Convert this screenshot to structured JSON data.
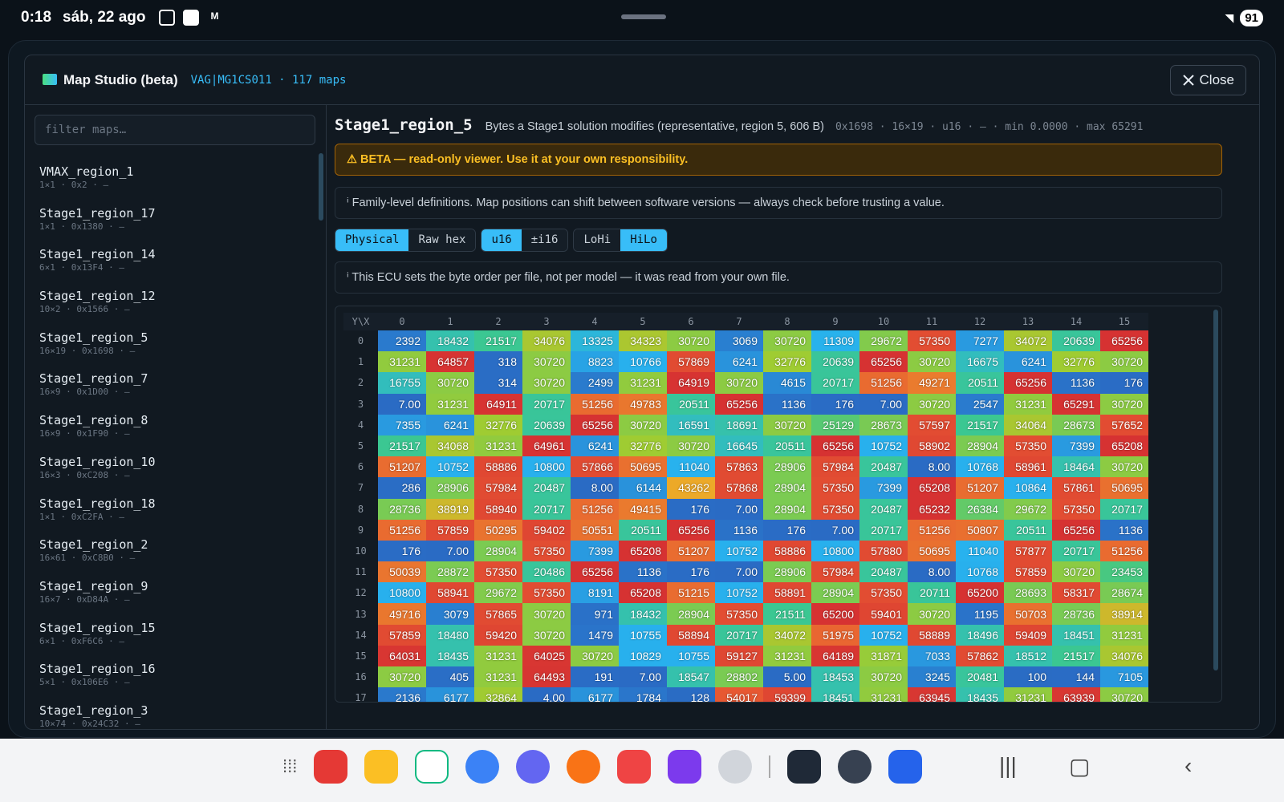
{
  "status": {
    "time": "0:18",
    "date": "sáb, 22 ago",
    "battery": "91"
  },
  "modal": {
    "title": "Map Studio (beta)",
    "subtitle": "VAG|MG1CS011 · 117 maps",
    "close_label": "Close"
  },
  "sidebar": {
    "filter_placeholder": "filter maps…",
    "items": [
      {
        "name": "VMAX_region_1",
        "meta": "1×1 · 0x2 · —"
      },
      {
        "name": "Stage1_region_17",
        "meta": "1×1 · 0x1380 · —"
      },
      {
        "name": "Stage1_region_14",
        "meta": "6×1 · 0x13F4 · —"
      },
      {
        "name": "Stage1_region_12",
        "meta": "10×2 · 0x1566 · —"
      },
      {
        "name": "Stage1_region_5",
        "meta": "16×19 · 0x1698 · —"
      },
      {
        "name": "Stage1_region_7",
        "meta": "16×9 · 0x1D00 · —"
      },
      {
        "name": "Stage1_region_8",
        "meta": "16×9 · 0x1F90 · —"
      },
      {
        "name": "Stage1_region_10",
        "meta": "16×3 · 0xC208 · —"
      },
      {
        "name": "Stage1_region_18",
        "meta": "1×1 · 0xC2FA · —"
      },
      {
        "name": "Stage1_region_2",
        "meta": "16×61 · 0xC8B0 · —"
      },
      {
        "name": "Stage1_region_9",
        "meta": "16×7 · 0xD84A · —"
      },
      {
        "name": "Stage1_region_15",
        "meta": "6×1 · 0xF6C6 · —"
      },
      {
        "name": "Stage1_region_16",
        "meta": "5×1 · 0x106E6 · —"
      },
      {
        "name": "Stage1_region_3",
        "meta": "10×74 · 0x24C32 · —"
      }
    ]
  },
  "map": {
    "name": "Stage1_region_5",
    "description": "Bytes a Stage1 solution modifies (representative, region 5, 606 B)",
    "meta": "0x1698 · 16×19 · u16 · — · min 0.0000 · max 65291",
    "warning": "⚠ BETA — read-only viewer. Use it at your own responsibility.",
    "info1": "ⁱ Family-level definitions. Map positions can shift between software versions — always check before trusting a value.",
    "info2": "ⁱ This ECU sets the byte order per file, not per model — it was read from your own file."
  },
  "toggles": [
    {
      "group": "view",
      "options": [
        {
          "label": "Physical",
          "active": true
        },
        {
          "label": "Raw hex",
          "active": false
        }
      ]
    },
    {
      "group": "type",
      "options": [
        {
          "label": "u16",
          "active": true
        },
        {
          "label": "±i16",
          "active": false
        }
      ]
    },
    {
      "group": "order",
      "options": [
        {
          "label": "LoHi",
          "active": false
        },
        {
          "label": "HiLo",
          "active": true
        }
      ]
    }
  ],
  "grid": {
    "corner": "Y\\X",
    "x": [
      "0",
      "1",
      "2",
      "3",
      "4",
      "5",
      "6",
      "7",
      "8",
      "9",
      "10",
      "11",
      "12",
      "13",
      "14",
      "15"
    ],
    "y": [
      "0",
      "1",
      "2",
      "3",
      "4",
      "5",
      "6",
      "7",
      "8",
      "9",
      "10",
      "11",
      "12",
      "13",
      "14",
      "15",
      "16",
      "17"
    ],
    "rows": [
      [
        "2392",
        "18432",
        "21517",
        "34076",
        "13325",
        "34323",
        "30720",
        "3069",
        "30720",
        "11309",
        "29672",
        "57350",
        "7277",
        "34072",
        "20639",
        "65256"
      ],
      [
        "31231",
        "64857",
        "318",
        "30720",
        "8823",
        "10766",
        "57869",
        "6241",
        "32776",
        "20639",
        "65256",
        "30720",
        "16675",
        "6241",
        "32776",
        "30720"
      ],
      [
        "16755",
        "30720",
        "314",
        "30720",
        "2499",
        "31231",
        "64919",
        "30720",
        "4615",
        "20717",
        "51256",
        "49271",
        "20511",
        "65256",
        "1136",
        "176"
      ],
      [
        "7.00",
        "31231",
        "64911",
        "20717",
        "51256",
        "49783",
        "20511",
        "65256",
        "1136",
        "176",
        "7.00",
        "30720",
        "2547",
        "31231",
        "65291",
        "30720"
      ],
      [
        "7355",
        "6241",
        "32776",
        "20639",
        "65256",
        "30720",
        "16591",
        "18691",
        "30720",
        "25129",
        "28673",
        "57597",
        "21517",
        "34064",
        "28673",
        "57652"
      ],
      [
        "21517",
        "34068",
        "31231",
        "64961",
        "6241",
        "32776",
        "30720",
        "16645",
        "20511",
        "65256",
        "10752",
        "58902",
        "28904",
        "57350",
        "7399",
        "65208"
      ],
      [
        "51207",
        "10752",
        "58886",
        "10800",
        "57866",
        "50695",
        "11040",
        "57863",
        "28906",
        "57984",
        "20487",
        "8.00",
        "10768",
        "58961",
        "18464",
        "30720"
      ],
      [
        "286",
        "28906",
        "57984",
        "20487",
        "8.00",
        "6144",
        "43262",
        "57868",
        "28904",
        "57350",
        "7399",
        "65208",
        "51207",
        "10864",
        "57861",
        "50695"
      ],
      [
        "28736",
        "38919",
        "58940",
        "20717",
        "51256",
        "49415",
        "176",
        "7.00",
        "28904",
        "57350",
        "20487",
        "65232",
        "26384",
        "29672",
        "57350",
        "20717"
      ],
      [
        "51256",
        "57859",
        "50295",
        "59402",
        "50551",
        "20511",
        "65256",
        "1136",
        "176",
        "7.00",
        "20717",
        "51256",
        "50807",
        "20511",
        "65256",
        "1136"
      ],
      [
        "176",
        "7.00",
        "28904",
        "57350",
        "7399",
        "65208",
        "51207",
        "10752",
        "58886",
        "10800",
        "57880",
        "50695",
        "11040",
        "57877",
        "20717",
        "51256"
      ],
      [
        "50039",
        "28872",
        "57350",
        "20486",
        "65256",
        "1136",
        "176",
        "7.00",
        "28906",
        "57984",
        "20487",
        "8.00",
        "10768",
        "57859",
        "30720",
        "23453"
      ],
      [
        "10800",
        "58941",
        "29672",
        "57350",
        "8191",
        "65208",
        "51215",
        "10752",
        "58891",
        "28904",
        "57350",
        "20711",
        "65200",
        "28693",
        "58317",
        "28674"
      ],
      [
        "49716",
        "3079",
        "57865",
        "30720",
        "971",
        "18432",
        "28904",
        "57350",
        "21511",
        "65200",
        "59401",
        "30720",
        "1195",
        "50703",
        "28736",
        "38914"
      ],
      [
        "57859",
        "18480",
        "59420",
        "30720",
        "1479",
        "10755",
        "58894",
        "20717",
        "34072",
        "51975",
        "10752",
        "58889",
        "18496",
        "59409",
        "18451",
        "31231"
      ],
      [
        "64031",
        "18435",
        "31231",
        "64025",
        "30720",
        "10829",
        "10755",
        "59127",
        "31231",
        "64189",
        "31871",
        "7033",
        "57862",
        "18512",
        "21517",
        "34076"
      ],
      [
        "30720",
        "405",
        "31231",
        "64493",
        "191",
        "7.00",
        "18547",
        "28802",
        "5.00",
        "18453",
        "30720",
        "3245",
        "20481",
        "100",
        "144",
        "7105"
      ],
      [
        "2136",
        "6177",
        "32864",
        "4.00",
        "6177",
        "1784",
        "128",
        "54017",
        "59399",
        "18451",
        "31231",
        "63945",
        "18435",
        "31231",
        "63939",
        "30720"
      ]
    ]
  },
  "colors": {
    "accent": "#38bdf8",
    "warning": "#fbbf24"
  }
}
